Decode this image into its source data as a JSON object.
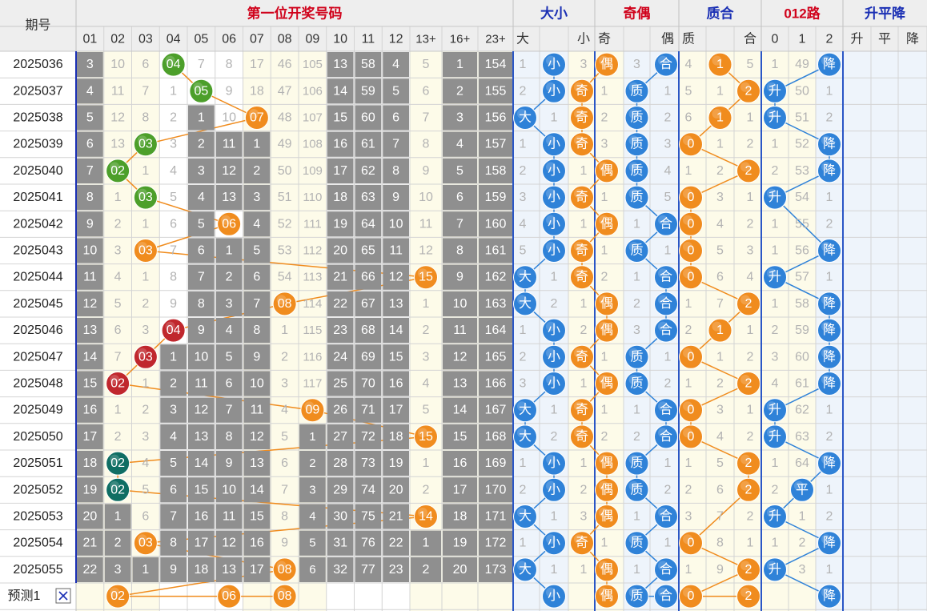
{
  "header": {
    "period_label": "期号",
    "group_main": "第一位开奖号码",
    "group_dx": "大小",
    "group_jo": "奇偶",
    "group_zh": "质合",
    "group_road": "012路",
    "group_trend": "升平降",
    "cols_main": [
      "01",
      "02",
      "03",
      "04",
      "05",
      "06",
      "07",
      "08",
      "09",
      "10",
      "11",
      "12",
      "13+",
      "16+",
      "23+"
    ],
    "cols_dx": [
      "大",
      "小"
    ],
    "cols_jo": [
      "奇",
      "偶"
    ],
    "cols_zh": [
      "质",
      "合"
    ],
    "cols_road": [
      "0",
      "1",
      "2"
    ],
    "cols_trend": [
      "升",
      "平",
      "降"
    ]
  },
  "predict": {
    "label": "预测1",
    "close_icon": "close-icon"
  },
  "chart_data": {
    "type": "table",
    "title": "第一位开奖号码",
    "periods": [
      "2025036",
      "2025037",
      "2025038",
      "2025039",
      "2025040",
      "2025041",
      "2025042",
      "2025043",
      "2025044",
      "2025045",
      "2025046",
      "2025047",
      "2025048",
      "2025049",
      "2025050",
      "2025051",
      "2025052",
      "2025053",
      "2025054",
      "2025055"
    ],
    "cells": [
      [
        "3",
        "10",
        "6",
        "04",
        "7",
        "8",
        "17",
        "46",
        "105",
        "13",
        "58",
        "4",
        "5",
        "1",
        "154",
        "1",
        "小",
        "3",
        "偶",
        "3",
        "合",
        "4",
        "1",
        "5",
        "1",
        "49",
        "降"
      ],
      [
        "4",
        "11",
        "7",
        "1",
        "05",
        "9",
        "18",
        "47",
        "106",
        "14",
        "59",
        "5",
        "6",
        "2",
        "155",
        "2",
        "小",
        "奇",
        "1",
        "质",
        "1",
        "5",
        "1",
        "2",
        "升",
        "50",
        "1"
      ],
      [
        "5",
        "12",
        "8",
        "2",
        "1",
        "10",
        "07",
        "48",
        "107",
        "15",
        "60",
        "6",
        "7",
        "3",
        "156",
        "大",
        "1",
        "奇",
        "2",
        "质",
        "2",
        "6",
        "1",
        "1",
        "升",
        "51",
        "2"
      ],
      [
        "6",
        "13",
        "03",
        "3",
        "2",
        "11",
        "1",
        "49",
        "108",
        "16",
        "61",
        "7",
        "8",
        "4",
        "157",
        "1",
        "小",
        "奇",
        "3",
        "质",
        "3",
        "0",
        "1",
        "2",
        "1",
        "52",
        "降"
      ],
      [
        "7",
        "02",
        "1",
        "4",
        "3",
        "12",
        "2",
        "50",
        "109",
        "17",
        "62",
        "8",
        "9",
        "5",
        "158",
        "2",
        "小",
        "1",
        "偶",
        "质",
        "4",
        "1",
        "2",
        "2",
        "2",
        "53",
        "降"
      ],
      [
        "8",
        "1",
        "03",
        "5",
        "4",
        "13",
        "3",
        "51",
        "110",
        "18",
        "63",
        "9",
        "10",
        "6",
        "159",
        "3",
        "小",
        "奇",
        "1",
        "质",
        "5",
        "0",
        "3",
        "1",
        "升",
        "54",
        "1"
      ],
      [
        "9",
        "2",
        "1",
        "6",
        "5",
        "06",
        "4",
        "52",
        "111",
        "19",
        "64",
        "10",
        "11",
        "7",
        "160",
        "4",
        "小",
        "1",
        "偶",
        "1",
        "合",
        "0",
        "4",
        "2",
        "1",
        "55",
        "2"
      ],
      [
        "10",
        "3",
        "03",
        "7",
        "6",
        "1",
        "5",
        "53",
        "112",
        "20",
        "65",
        "11",
        "12",
        "8",
        "161",
        "5",
        "小",
        "奇",
        "1",
        "质",
        "1",
        "0",
        "5",
        "3",
        "1",
        "56",
        "降"
      ],
      [
        "11",
        "4",
        "1",
        "8",
        "7",
        "2",
        "6",
        "54",
        "113",
        "21",
        "66",
        "12",
        "15",
        "9",
        "162",
        "大",
        "1",
        "奇",
        "2",
        "1",
        "合",
        "0",
        "6",
        "4",
        "升",
        "57",
        "1"
      ],
      [
        "12",
        "5",
        "2",
        "9",
        "8",
        "3",
        "7",
        "08",
        "114",
        "22",
        "67",
        "13",
        "1",
        "10",
        "163",
        "大",
        "2",
        "1",
        "偶",
        "2",
        "合",
        "1",
        "7",
        "2",
        "1",
        "58",
        "降"
      ],
      [
        "13",
        "6",
        "3",
        "04",
        "9",
        "4",
        "8",
        "1",
        "115",
        "23",
        "68",
        "14",
        "2",
        "11",
        "164",
        "1",
        "小",
        "2",
        "偶",
        "3",
        "合",
        "2",
        "1",
        "1",
        "2",
        "59",
        "降"
      ],
      [
        "14",
        "7",
        "03",
        "1",
        "10",
        "5",
        "9",
        "2",
        "116",
        "24",
        "69",
        "15",
        "3",
        "12",
        "165",
        "2",
        "小",
        "奇",
        "1",
        "质",
        "1",
        "0",
        "1",
        "2",
        "3",
        "60",
        "降"
      ],
      [
        "15",
        "02",
        "1",
        "2",
        "11",
        "6",
        "10",
        "3",
        "117",
        "25",
        "70",
        "16",
        "4",
        "13",
        "166",
        "3",
        "小",
        "1",
        "偶",
        "质",
        "2",
        "1",
        "2",
        "2",
        "4",
        "61",
        "降"
      ],
      [
        "16",
        "1",
        "2",
        "3",
        "12",
        "7",
        "11",
        "4",
        "09",
        "26",
        "71",
        "17",
        "5",
        "14",
        "167",
        "大",
        "1",
        "奇",
        "1",
        "1",
        "合",
        "0",
        "3",
        "1",
        "升",
        "62",
        "1"
      ],
      [
        "17",
        "2",
        "3",
        "4",
        "13",
        "8",
        "12",
        "5",
        "1",
        "27",
        "72",
        "18",
        "15",
        "15",
        "168",
        "大",
        "2",
        "奇",
        "2",
        "2",
        "合",
        "0",
        "4",
        "2",
        "升",
        "63",
        "2"
      ],
      [
        "18",
        "02",
        "4",
        "5",
        "14",
        "9",
        "13",
        "6",
        "2",
        "28",
        "73",
        "19",
        "1",
        "16",
        "169",
        "1",
        "小",
        "1",
        "偶",
        "质",
        "1",
        "1",
        "5",
        "2",
        "1",
        "64",
        "降"
      ],
      [
        "19",
        "02",
        "5",
        "6",
        "15",
        "10",
        "14",
        "7",
        "3",
        "29",
        "74",
        "20",
        "2",
        "17",
        "170",
        "2",
        "小",
        "2",
        "偶",
        "质",
        "2",
        "2",
        "6",
        "2",
        "2",
        "平",
        "1"
      ],
      [
        "20",
        "1",
        "6",
        "7",
        "16",
        "11",
        "15",
        "8",
        "4",
        "30",
        "75",
        "21",
        "14",
        "18",
        "171",
        "大",
        "1",
        "3",
        "偶",
        "1",
        "合",
        "3",
        "7",
        "2",
        "升",
        "1",
        "2"
      ],
      [
        "21",
        "2",
        "03",
        "8",
        "17",
        "12",
        "16",
        "9",
        "5",
        "31",
        "76",
        "22",
        "1",
        "19",
        "172",
        "1",
        "小",
        "奇",
        "1",
        "质",
        "1",
        "0",
        "8",
        "1",
        "1",
        "2",
        "降"
      ],
      [
        "22",
        "3",
        "1",
        "9",
        "18",
        "13",
        "17",
        "08",
        "6",
        "32",
        "77",
        "23",
        "2",
        "20",
        "173",
        "大",
        "1",
        "1",
        "偶",
        "1",
        "合",
        "1",
        "9",
        "2",
        "升",
        "3",
        "1"
      ]
    ],
    "predict_cells": [
      "",
      "02",
      "",
      "",
      "",
      "06",
      "",
      "08",
      "",
      "",
      "",
      "",
      "",
      "",
      "",
      "",
      "小",
      "",
      "偶",
      "质",
      "合",
      "0",
      "",
      "2",
      "",
      "",
      "降"
    ]
  }
}
